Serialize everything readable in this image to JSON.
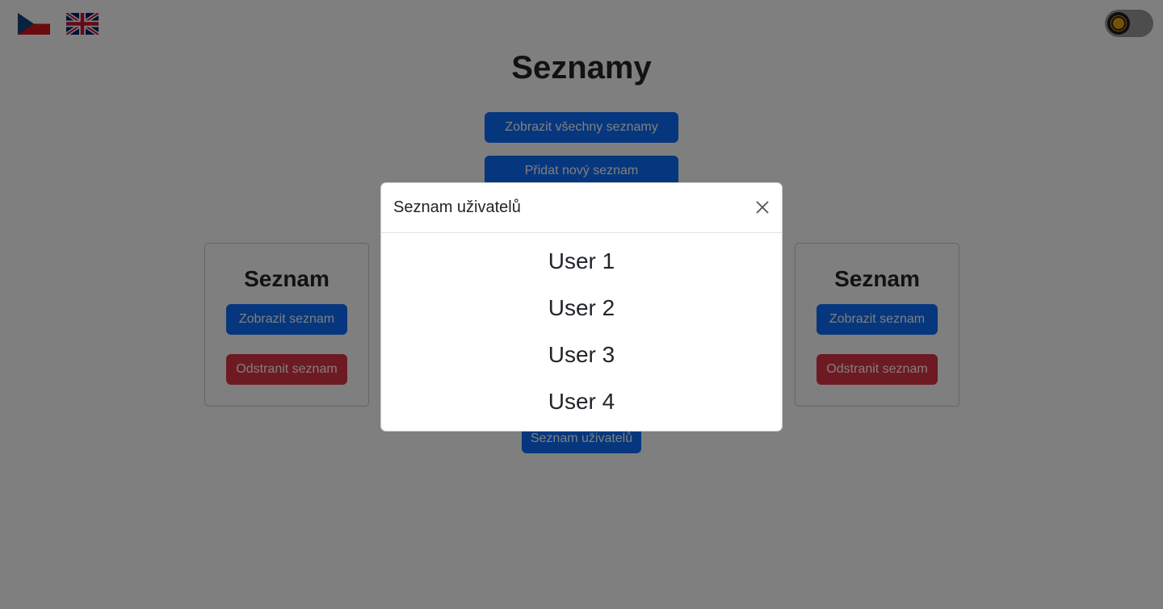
{
  "header": {
    "flags": [
      {
        "name": "czech-flag",
        "label": "CZ"
      },
      {
        "name": "uk-flag",
        "label": "EN"
      }
    ],
    "theme_toggle": {
      "icon": "sun-icon",
      "state": "light"
    }
  },
  "main": {
    "title": "Seznamy",
    "show_all_label": "Zobrazit všechny seznamy",
    "add_new_label": "Přidat nový seznam",
    "users_list_label": "Seznam uživatelů",
    "cards": [
      {
        "title": "Seznam",
        "view_label": "Zobrazit seznam",
        "delete_label": "Odstranit seznam"
      },
      {
        "title": "Seznam",
        "view_label": "Zobrazit seznam",
        "delete_label": "Odstranit seznam"
      }
    ]
  },
  "modal": {
    "title": "Seznam uživatelů",
    "close_icon": "close-icon",
    "users": [
      "User 1",
      "User 2",
      "User 3",
      "User 4"
    ]
  },
  "colors": {
    "primary": "#0d6efd",
    "danger": "#dc3545",
    "backdrop": "rgba(0,0,0,0.5)"
  }
}
